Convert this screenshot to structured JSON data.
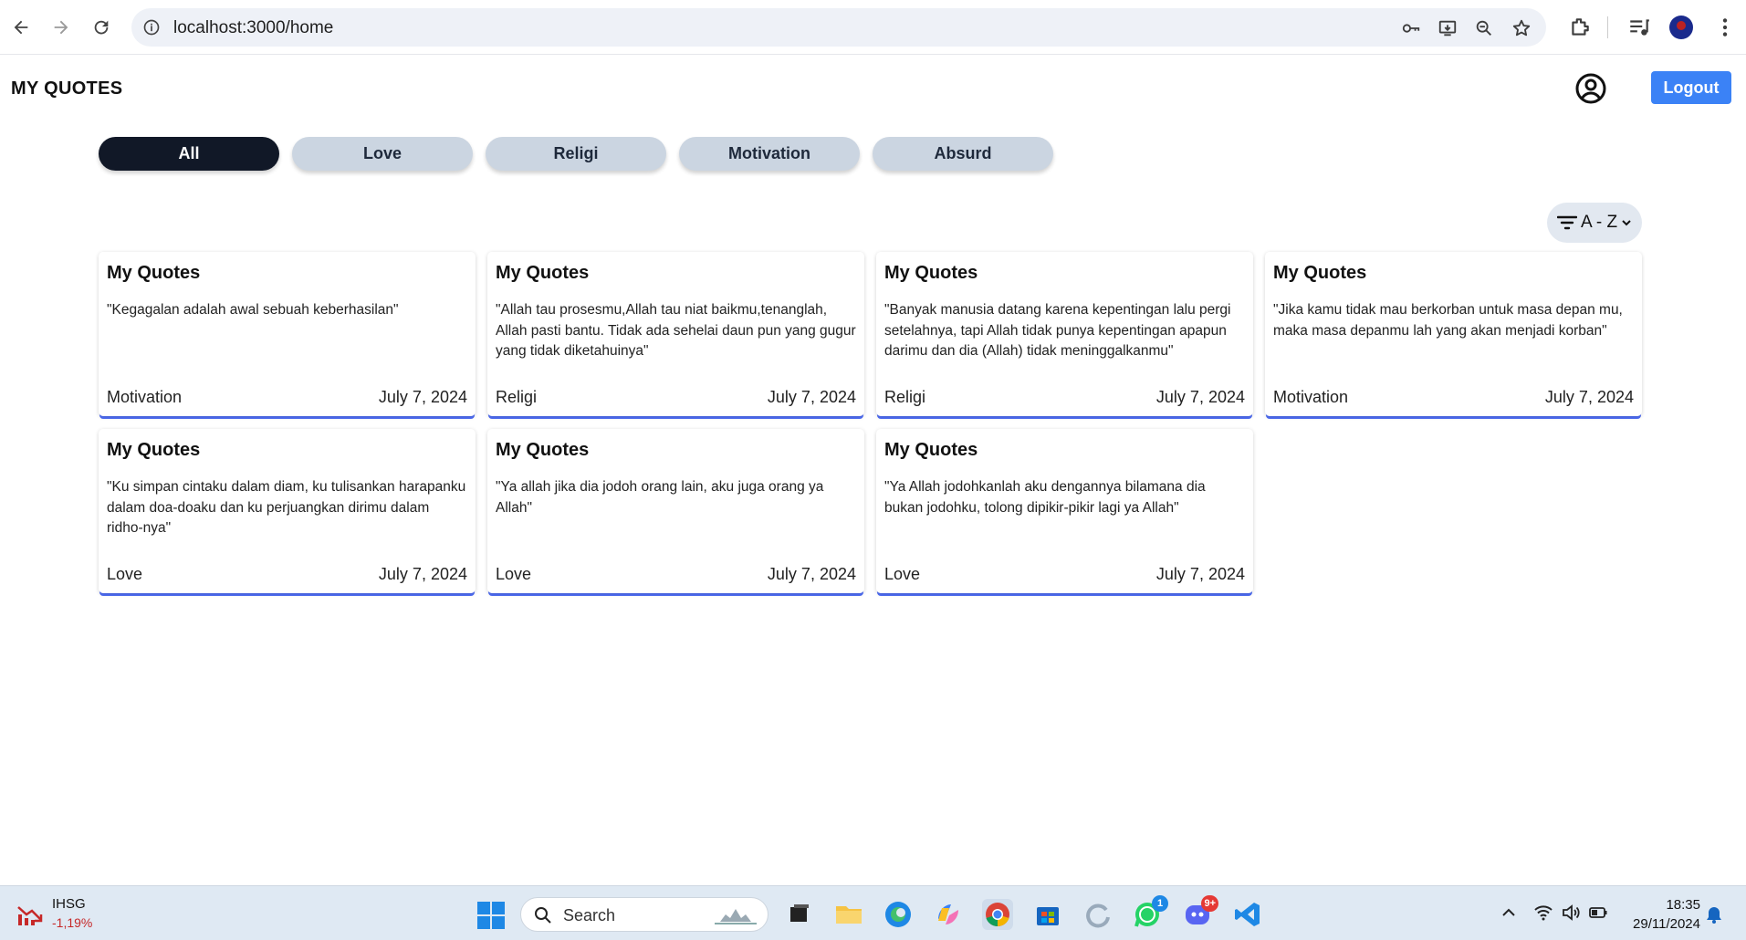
{
  "browser": {
    "url": "localhost:3000/home"
  },
  "app": {
    "title": "MY QUOTES",
    "logout_label": "Logout"
  },
  "filters": [
    {
      "label": "All",
      "active": true
    },
    {
      "label": "Love",
      "active": false
    },
    {
      "label": "Religi",
      "active": false
    },
    {
      "label": "Motivation",
      "active": false
    },
    {
      "label": "Absurd",
      "active": false
    }
  ],
  "sort": {
    "label": "A - Z"
  },
  "cards": [
    {
      "title": "My Quotes",
      "text": "\"Kegagalan adalah awal sebuah keberhasilan\"",
      "category": "Motivation",
      "date": "July 7, 2024"
    },
    {
      "title": "My Quotes",
      "text": "\"Allah tau prosesmu,Allah tau niat baikmu,tenanglah, Allah pasti bantu. Tidak ada sehelai daun pun yang gugur yang tidak diketahuinya\"",
      "category": "Religi",
      "date": "July 7, 2024"
    },
    {
      "title": "My Quotes",
      "text": "\"Banyak manusia datang karena kepentingan lalu pergi setelahnya, tapi Allah tidak punya kepentingan apapun darimu dan dia (Allah) tidak meninggalkanmu\"",
      "category": "Religi",
      "date": "July 7, 2024"
    },
    {
      "title": "My Quotes",
      "text": "\"Jika kamu tidak mau berkorban untuk masa depan mu, maka masa depanmu lah yang akan menjadi korban\"",
      "category": "Motivation",
      "date": "July 7, 2024"
    },
    {
      "title": "My Quotes",
      "text": "\"Ku simpan cintaku dalam diam, ku tulisankan harapanku dalam doa-doaku dan ku perjuangkan dirimu dalam ridho-nya\"",
      "category": "Love",
      "date": "July 7, 2024"
    },
    {
      "title": "My Quotes",
      "text": "\"Ya allah jika dia jodoh orang lain, aku juga orang ya Allah\"",
      "category": "Love",
      "date": "July 7, 2024"
    },
    {
      "title": "My Quotes",
      "text": "\"Ya Allah jodohkanlah aku dengannya bilamana dia bukan jodohku, tolong dipikir-pikir lagi ya Allah\"",
      "category": "Love",
      "date": "July 7, 2024"
    }
  ],
  "taskbar": {
    "stock_name": "IHSG",
    "stock_change": "-1,19%",
    "search_label": "Search",
    "whatsapp_badge": "1",
    "discord_badge": "9+",
    "time": "18:35",
    "date": "29/11/2024"
  },
  "colors": {
    "accent": "#3b82f6",
    "active_filter": "#111827",
    "filter": "#cbd5e1",
    "card_shadow": "#4f6ef7"
  }
}
